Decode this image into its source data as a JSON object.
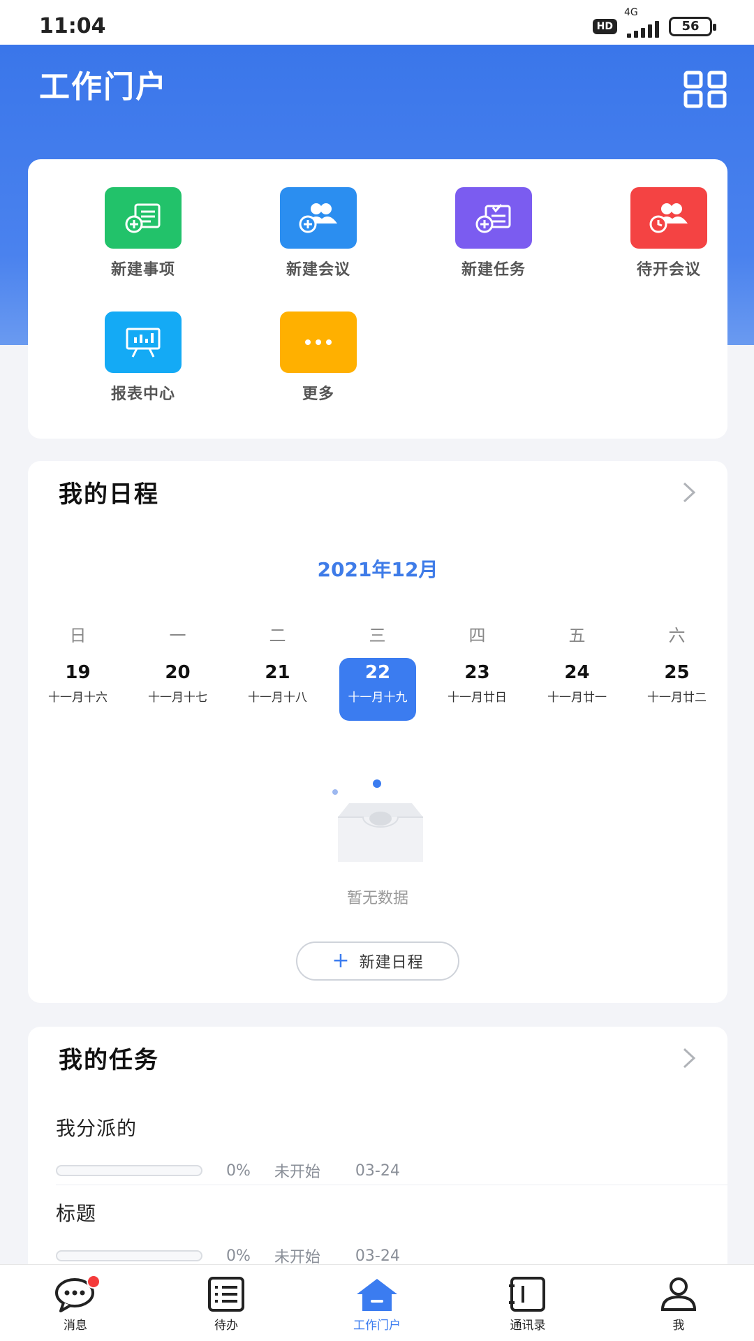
{
  "status_bar": {
    "time": "11:04",
    "hd": "HD",
    "network": "4G",
    "battery": "56"
  },
  "header": {
    "title": "工作门户",
    "grid_icon": "grid-icon"
  },
  "quick_actions": [
    {
      "label": "新建事项",
      "icon": "new-item-icon",
      "color": "#22c26a"
    },
    {
      "label": "新建会议",
      "icon": "new-meeting-icon",
      "color": "#2b8ef0"
    },
    {
      "label": "新建任务",
      "icon": "new-task-icon",
      "color": "#7b5cf0"
    },
    {
      "label": "待开会议",
      "icon": "pending-meeting-icon",
      "color": "#f44343"
    },
    {
      "label": "报表中心",
      "icon": "report-center-icon",
      "color": "#14aaf5"
    },
    {
      "label": "更多",
      "icon": "more-icon",
      "color": "#ffb000"
    }
  ],
  "schedule": {
    "title": "我的日程",
    "month": "2021年12月",
    "weekdays": [
      "日",
      "一",
      "二",
      "三",
      "四",
      "五",
      "六"
    ],
    "days": [
      {
        "num": "19",
        "lunar": "十一月十六"
      },
      {
        "num": "20",
        "lunar": "十一月十七"
      },
      {
        "num": "21",
        "lunar": "十一月十八"
      },
      {
        "num": "22",
        "lunar": "十一月十九"
      },
      {
        "num": "23",
        "lunar": "十一月廿日"
      },
      {
        "num": "24",
        "lunar": "十一月廿一"
      },
      {
        "num": "25",
        "lunar": "十一月廿二"
      }
    ],
    "selected_index": 3,
    "empty_text": "暂无数据",
    "new_button": "新建日程"
  },
  "tasks": {
    "title": "我的任务",
    "items": [
      {
        "title": "我分派的",
        "progress": 0,
        "percent": "0%",
        "status": "未开始",
        "date": "03-24"
      },
      {
        "title": "标题",
        "progress": 0,
        "percent": "0%",
        "status": "未开始",
        "date": "03-24"
      }
    ]
  },
  "tabbar": {
    "items": [
      {
        "label": "消息",
        "icon": "message-icon",
        "active": false,
        "has_badge": true
      },
      {
        "label": "待办",
        "icon": "todo-icon",
        "active": false
      },
      {
        "label": "工作门户",
        "icon": "home-icon",
        "active": true
      },
      {
        "label": "通讯录",
        "icon": "contacts-icon",
        "active": false
      },
      {
        "label": "我",
        "icon": "profile-icon",
        "active": false
      }
    ]
  },
  "colors": {
    "primary": "#3b7cf0",
    "header": "#3a76ea"
  }
}
